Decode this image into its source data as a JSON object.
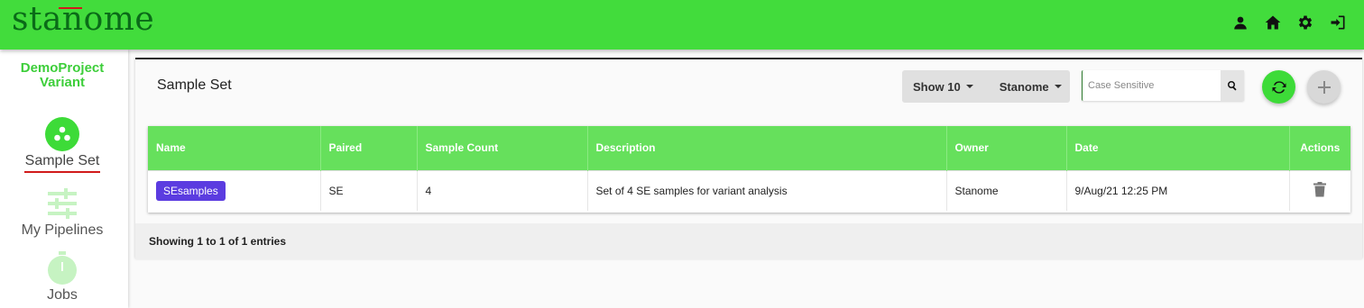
{
  "brand": {
    "logo": "stanome"
  },
  "header": {
    "icons": [
      "person-icon",
      "home-icon",
      "gear-icon",
      "logout-icon"
    ]
  },
  "sidebar": {
    "project": "DemoProject Variant",
    "items": [
      {
        "label": "Sample Set",
        "icon": "sample-set-icon",
        "active": true
      },
      {
        "label": "My Pipelines",
        "icon": "sliders-icon",
        "active": false
      },
      {
        "label": "Jobs",
        "icon": "stopwatch-icon",
        "active": false
      }
    ]
  },
  "main": {
    "title": "Sample Set",
    "show_label": "Show 10",
    "owner_filter": "Stanome",
    "search": {
      "placeholder": "Case Sensitive",
      "value": ""
    },
    "table": {
      "columns": [
        "Name",
        "Paired",
        "Sample Count",
        "Description",
        "Owner",
        "Date",
        "Actions"
      ],
      "rows": [
        {
          "name": "SEsamples",
          "paired": "SE",
          "sample_count": "4",
          "description": "Set of 4 SE samples for variant analysis",
          "owner": "Stanome",
          "date": "9/Aug/21 12:25 PM"
        }
      ]
    },
    "footer": "Showing 1 to 1 of 1 entries"
  },
  "colors": {
    "brand_green": "#42dc3c",
    "header_green": "#66e05c",
    "tag_purple": "#5b3ce0",
    "accent_red": "#d11a1a"
  }
}
